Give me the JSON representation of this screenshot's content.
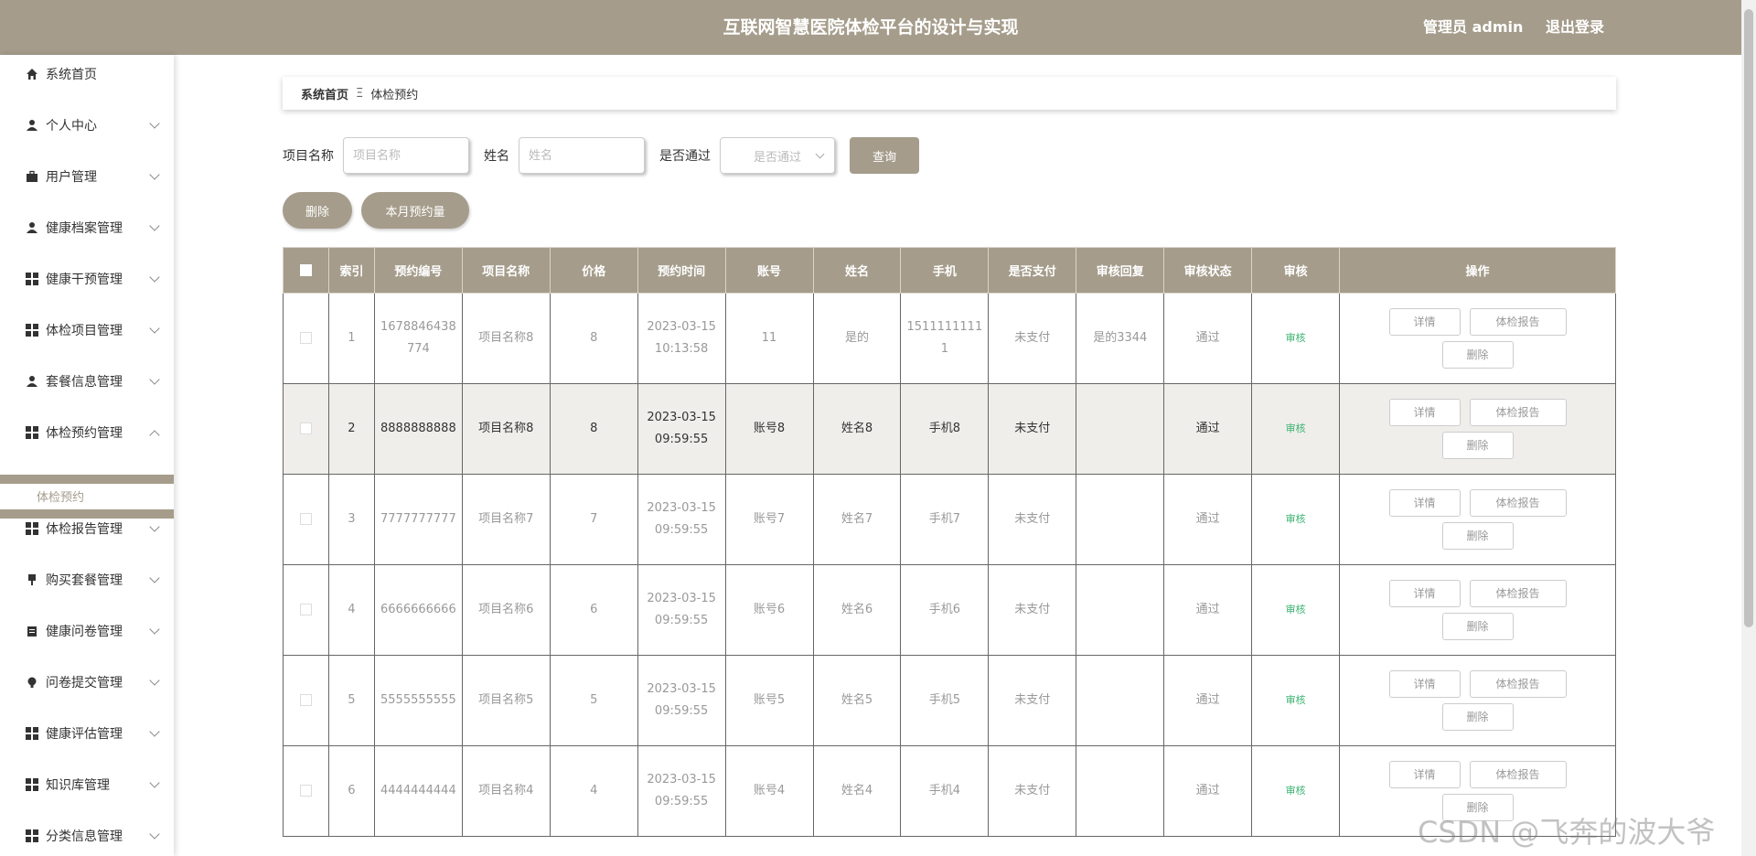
{
  "header": {
    "title": "互联网智慧医院体检平台的设计与实现",
    "admin": "管理员 admin",
    "logout": "退出登录"
  },
  "sidebar": {
    "items": [
      {
        "label": "系统首页",
        "icon": "home-icon"
      },
      {
        "label": "个人中心",
        "icon": "user-icon"
      },
      {
        "label": "用户管理",
        "icon": "briefcase-icon"
      },
      {
        "label": "健康档案管理",
        "icon": "user-icon"
      },
      {
        "label": "健康干预管理",
        "icon": "grid-icon"
      },
      {
        "label": "体检项目管理",
        "icon": "grid-icon"
      },
      {
        "label": "套餐信息管理",
        "icon": "user-icon"
      },
      {
        "label": "体检预约管理",
        "icon": "grid-icon"
      },
      {
        "label": "体检报告管理",
        "icon": "grid-icon"
      },
      {
        "label": "购买套餐管理",
        "icon": "pin-icon"
      },
      {
        "label": "健康问卷管理",
        "icon": "clipboard-icon"
      },
      {
        "label": "问卷提交管理",
        "icon": "bulb-icon"
      },
      {
        "label": "健康评估管理",
        "icon": "grid-icon"
      },
      {
        "label": "知识库管理",
        "icon": "grid-icon"
      },
      {
        "label": "分类信息管理",
        "icon": "grid-icon"
      }
    ],
    "sub_item": "体检预约"
  },
  "breadcrumb": {
    "home": "系统首页",
    "separator": "Ξ",
    "current": "体检预约"
  },
  "search": {
    "project_label": "项目名称",
    "project_placeholder": "项目名称",
    "name_label": "姓名",
    "name_placeholder": "姓名",
    "passed_label": "是否通过",
    "passed_placeholder": "是否通过",
    "query_button": "查询"
  },
  "actions": {
    "delete": "删除",
    "monthly": "本月预约量"
  },
  "table": {
    "columns": [
      "索引",
      "预约编号",
      "项目名称",
      "价格",
      "预约时间",
      "账号",
      "姓名",
      "手机",
      "是否支付",
      "审核回复",
      "审核状态",
      "审核",
      "操作"
    ],
    "buttons": {
      "detail": "详情",
      "report": "体检报告",
      "delete": "删除"
    },
    "rows": [
      {
        "idx": "1",
        "code": "1678846438774",
        "project": "项目名称8",
        "price": "8",
        "time": "2023-03-15 10:13:58",
        "account": "11",
        "name": "是的",
        "phone": "15111111111",
        "paid": "未支付",
        "reply": "是的3344",
        "status": "通过",
        "audit": "审核"
      },
      {
        "idx": "2",
        "code": "8888888888",
        "project": "项目名称8",
        "price": "8",
        "time": "2023-03-15 09:59:55",
        "account": "账号8",
        "name": "姓名8",
        "phone": "手机8",
        "paid": "未支付",
        "reply": "",
        "status": "通过",
        "audit": "审核"
      },
      {
        "idx": "3",
        "code": "7777777777",
        "project": "项目名称7",
        "price": "7",
        "time": "2023-03-15 09:59:55",
        "account": "账号7",
        "name": "姓名7",
        "phone": "手机7",
        "paid": "未支付",
        "reply": "",
        "status": "通过",
        "audit": "审核"
      },
      {
        "idx": "4",
        "code": "6666666666",
        "project": "项目名称6",
        "price": "6",
        "time": "2023-03-15 09:59:55",
        "account": "账号6",
        "name": "姓名6",
        "phone": "手机6",
        "paid": "未支付",
        "reply": "",
        "status": "通过",
        "audit": "审核"
      },
      {
        "idx": "5",
        "code": "5555555555",
        "project": "项目名称5",
        "price": "5",
        "time": "2023-03-15 09:59:55",
        "account": "账号5",
        "name": "姓名5",
        "phone": "手机5",
        "paid": "未支付",
        "reply": "",
        "status": "通过",
        "audit": "审核"
      },
      {
        "idx": "6",
        "code": "4444444444",
        "project": "项目名称4",
        "price": "4",
        "time": "2023-03-15 09:59:55",
        "account": "账号4",
        "name": "姓名4",
        "phone": "手机4",
        "paid": "未支付",
        "reply": "",
        "status": "通过",
        "audit": "审核"
      }
    ]
  },
  "watermark": "CSDN @飞奔的波大爷",
  "colors": {
    "primary": "#a59c8b",
    "audit": "#3cb371",
    "highlight_row": "#efeeeb"
  }
}
